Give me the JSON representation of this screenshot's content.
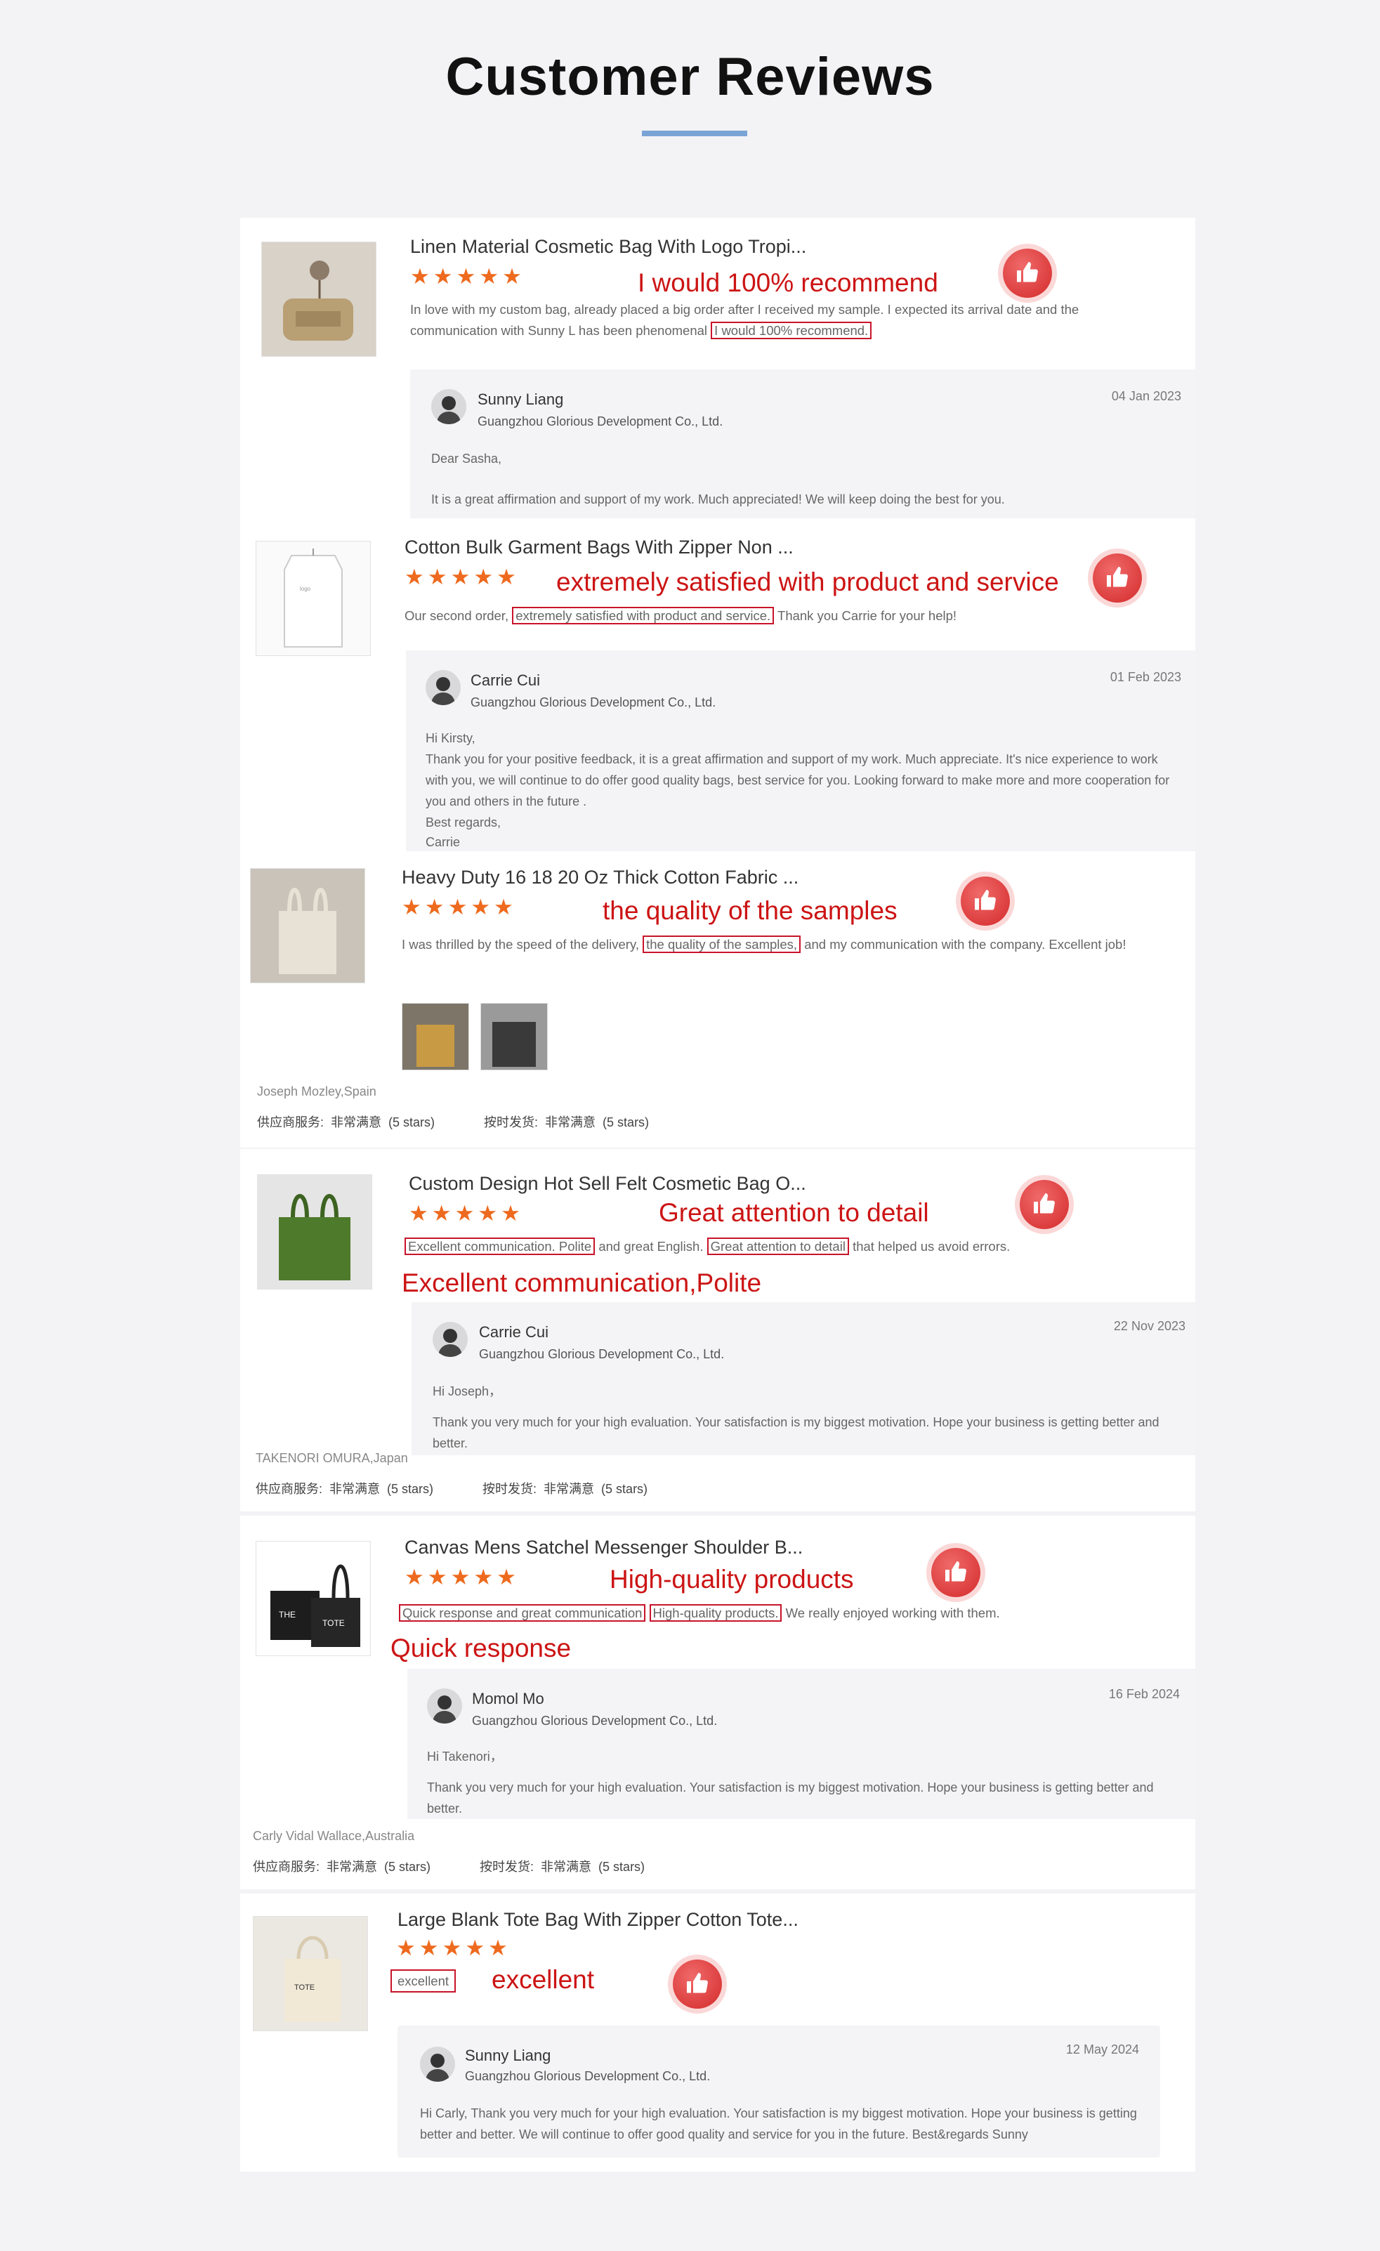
{
  "page_title": "Customer Reviews",
  "colors": {
    "accent_rule": "#7aa4d6",
    "stars": "#ee6a1e",
    "highlight": "#cc1414",
    "like_button": "#d42a2a"
  },
  "icons": {
    "like": "thumbs-up-icon",
    "star": "star-icon"
  },
  "reviews": [
    {
      "product_title": "Linen Material Cosmetic Bag With Logo Tropi...",
      "stars": "★★★★★",
      "highlight": "I would 100% recommend",
      "text_before": "In love with my custom bag, already placed a big order after I received my sample. I expected its arrival date and the communication with Sunny L has been phenomenal",
      "boxed": "I would 100% recommend.",
      "reply": {
        "name": "Sunny Liang",
        "company": "Guangzhou Glorious Development Co., Ltd.",
        "date": "04 Jan 2023",
        "line1": "Dear Sasha,",
        "line2": "It is a great affirmation and support of my work. Much appreciated! We will keep doing the best for you."
      }
    },
    {
      "product_title": "Cotton Bulk Garment Bags With Zipper Non ...",
      "stars": "★★★★★",
      "highlight": "extremely satisfied with product and service",
      "text_before": "Our second order,",
      "boxed": "extremely satisfied with product and service.",
      "text_after": "Thank you Carrie for your help!",
      "reply": {
        "name": "Carrie Cui",
        "company": "Guangzhou Glorious Development Co., Ltd.",
        "date": "01 Feb 2023",
        "line1": "Hi Kirsty,",
        "line2": "Thank you for your positive feedback, it is a great affirmation and support of my work. Much appreciate. It's nice experience to work with you, we will continue to do offer good quality bags, best service for you. Looking forward to make more and more cooperation for you and others in the future .",
        "line3": "Best regards,",
        "line4": "Carrie"
      }
    },
    {
      "product_title": "Heavy Duty 16 18 20 Oz Thick Cotton Fabric ...",
      "stars": "★★★★★",
      "highlight": "the quality of the samples",
      "text_before": "I was thrilled by the speed of the delivery,",
      "boxed": "the quality of the samples,",
      "text_after": "and my communication with the company. Excellent job!",
      "reviewer": "Joseph Mozley,Spain",
      "rating_service_label": "供应商服务:",
      "rating_service_value": "非常满意",
      "rating_service_stars": "(5 stars)",
      "rating_ship_label": "按时发货:",
      "rating_ship_value": "非常满意",
      "rating_ship_stars": "(5 stars)"
    },
    {
      "product_title": "Custom Design Hot Sell Felt Cosmetic Bag O...",
      "stars": "★★★★★",
      "highlight": "Great attention to detail",
      "highlight2": "Excellent communication,Polite",
      "boxed": "Excellent communication. Polite",
      "text_mid": "and great English.",
      "boxed2": "Great attention to detail",
      "text_after": "that helped us avoid errors.",
      "reply": {
        "name": "Carrie Cui",
        "company": "Guangzhou Glorious Development Co., Ltd.",
        "date": "22 Nov 2023",
        "line1": "Hi Joseph，",
        "line2": "Thank you very much for your high evaluation. Your satisfaction is my biggest motivation. Hope your business is getting better and better."
      },
      "reviewer": "TAKENORI OMURA,Japan",
      "rating_service_label": "供应商服务:",
      "rating_service_value": "非常满意",
      "rating_service_stars": "(5 stars)",
      "rating_ship_label": "按时发货:",
      "rating_ship_value": "非常满意",
      "rating_ship_stars": "(5 stars)"
    },
    {
      "product_title": "Canvas Mens Satchel Messenger Shoulder B...",
      "stars": "★★★★★",
      "highlight": "High-quality products",
      "highlight2": "Quick response",
      "boxed": "Quick response and great communication",
      "boxed2": "High-quality products.",
      "text_after": "We really enjoyed working with them.",
      "reply": {
        "name": "Momol Mo",
        "company": "Guangzhou Glorious Development Co., Ltd.",
        "date": "16 Feb 2024",
        "line1": "Hi Takenori，",
        "line2": "Thank you very much for your high evaluation. Your satisfaction is my biggest motivation. Hope your business is getting better and better."
      },
      "reviewer": "Carly Vidal Wallace,Australia",
      "rating_service_label": "供应商服务:",
      "rating_service_value": "非常满意",
      "rating_service_stars": "(5 stars)",
      "rating_ship_label": "按时发货:",
      "rating_ship_value": "非常满意",
      "rating_ship_stars": "(5 stars)"
    },
    {
      "product_title": "Large Blank Tote Bag With Zipper Cotton Tote...",
      "stars": "★★★★★",
      "highlight": "excellent",
      "boxed": "excellent",
      "reply": {
        "name": "Sunny Liang",
        "company": "Guangzhou Glorious Development Co., Ltd.",
        "date": "12 May 2024",
        "line1": "Hi Carly, Thank you very much for your high evaluation. Your satisfaction is my biggest motivation. Hope your business is getting better and better. We will continue to offer good quality and service for you in the future. Best&regards Sunny"
      }
    }
  ]
}
